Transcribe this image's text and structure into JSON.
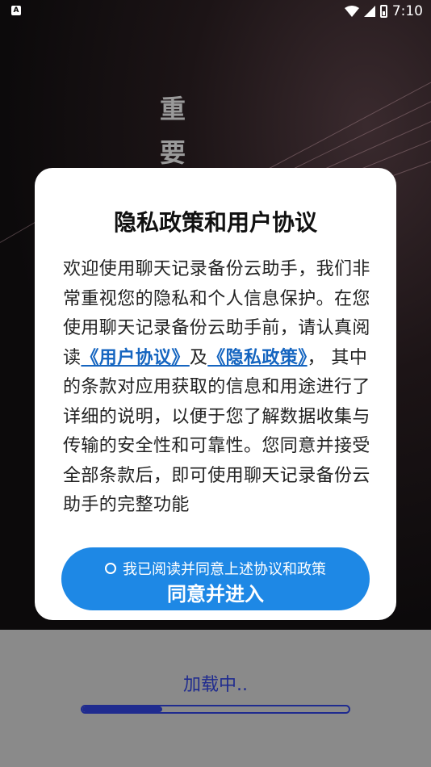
{
  "status_bar": {
    "time": "7:10",
    "left_icon": "A"
  },
  "background": {
    "vertical_title": [
      "重",
      "要"
    ]
  },
  "dialog": {
    "title": "隐私政策和用户协议",
    "body_part1": "欢迎使用聊天记录备份云助手，我们非常重视您的隐私和个人信息保护。在您使用聊天记录备份云助手前，请认真阅读",
    "user_agreement_link": "《用户协议》",
    "and_text": "及",
    "privacy_policy_link": "《隐私政策》",
    "body_part2": "， 其中的条款对应用获取的信息和用途进行了详细的说明，以便于您了解数据收集与传输的安全性和可靠性。您同意并接受全部条款后，即可使用聊天记录备份云助手的完整功能",
    "agree_checkbox_label": "我已阅读并同意上述协议和政策",
    "agree_button_label": "同意并进入"
  },
  "loading": {
    "text": "加载中..",
    "progress": 0.3
  }
}
